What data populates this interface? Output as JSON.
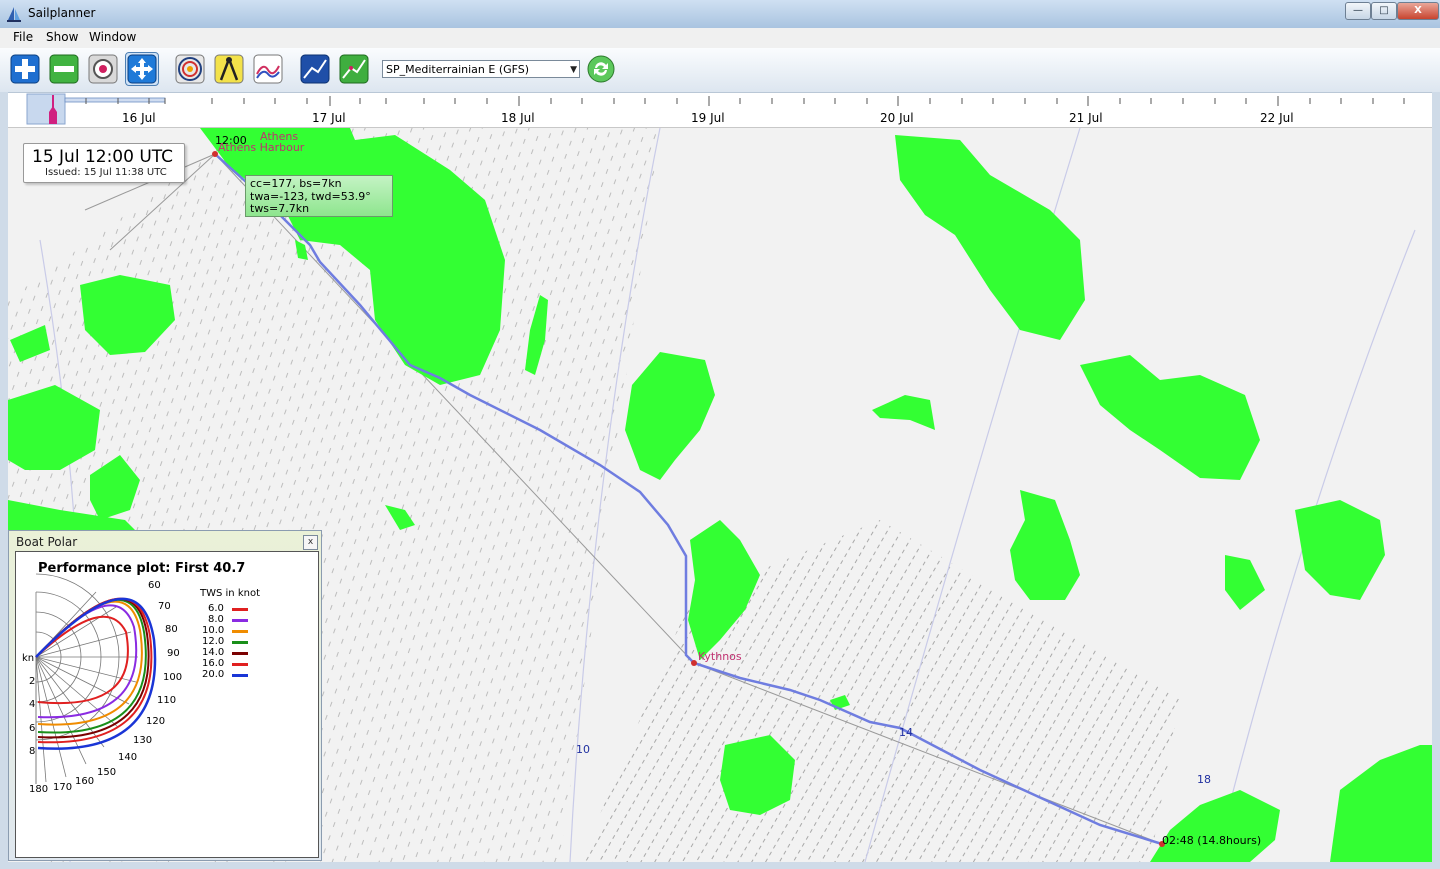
{
  "window": {
    "title": "Sailplanner",
    "minimize": "—",
    "maximize": "□",
    "close": "X"
  },
  "menu": [
    "File",
    "Show",
    "Window"
  ],
  "toolbar": {
    "buttons": [
      "add-icon",
      "remove-icon",
      "target-icon",
      "pan-icon",
      "weather-grid-icon",
      "compass-icon",
      "chart-icon",
      "route-graph-icon",
      "route-optimize-icon"
    ],
    "grib_select": "SP_Mediterrainian E (GFS)",
    "refresh": "refresh-icon"
  },
  "timeline": {
    "labels": [
      "16 Jul",
      "17 Jul",
      "18 Jul",
      "19 Jul",
      "20 Jul",
      "21 Jul",
      "22 Jul"
    ]
  },
  "datebox": {
    "main": "15 Jul 12:00 UTC",
    "issued": "Issued: 15 Jul 11:38 UTC"
  },
  "tooltip": {
    "line1": "cc=177,  bs=7kn",
    "line2": "twa=-123, twd=53.9°",
    "line3": "tws=7.7kn"
  },
  "map": {
    "start_time": "12:00",
    "start_name": "Athens",
    "start_harbour": "Athens Harbour",
    "waypoint": "Kythnos",
    "end_label": "02:48 (14.8hours)",
    "isochrones": [
      "10",
      "14",
      "18"
    ],
    "colors": {
      "land": "#33ff33",
      "route": "#6f7de0",
      "sea": "#f2f2f2"
    }
  },
  "polar": {
    "window_title": "Boat Polar",
    "close": "x",
    "heading": "Performance plot: First 40.7",
    "legend_title": "TWS in knot",
    "legend": [
      {
        "label": "6.0",
        "color": "#e02020"
      },
      {
        "label": "8.0",
        "color": "#8a2be2"
      },
      {
        "label": "10.0",
        "color": "#f08c00"
      },
      {
        "label": "12.0",
        "color": "#1a8f1a"
      },
      {
        "label": "14.0",
        "color": "#7a0000"
      },
      {
        "label": "16.0",
        "color": "#e02020"
      },
      {
        "label": "20.0",
        "color": "#1a35d6"
      }
    ],
    "angle_labels": [
      "60",
      "70",
      "80",
      "90",
      "100",
      "110",
      "120",
      "130",
      "140",
      "150",
      "160",
      "170",
      "180"
    ],
    "speed_labels": [
      "kn",
      "2",
      "4",
      "6",
      "8"
    ]
  }
}
